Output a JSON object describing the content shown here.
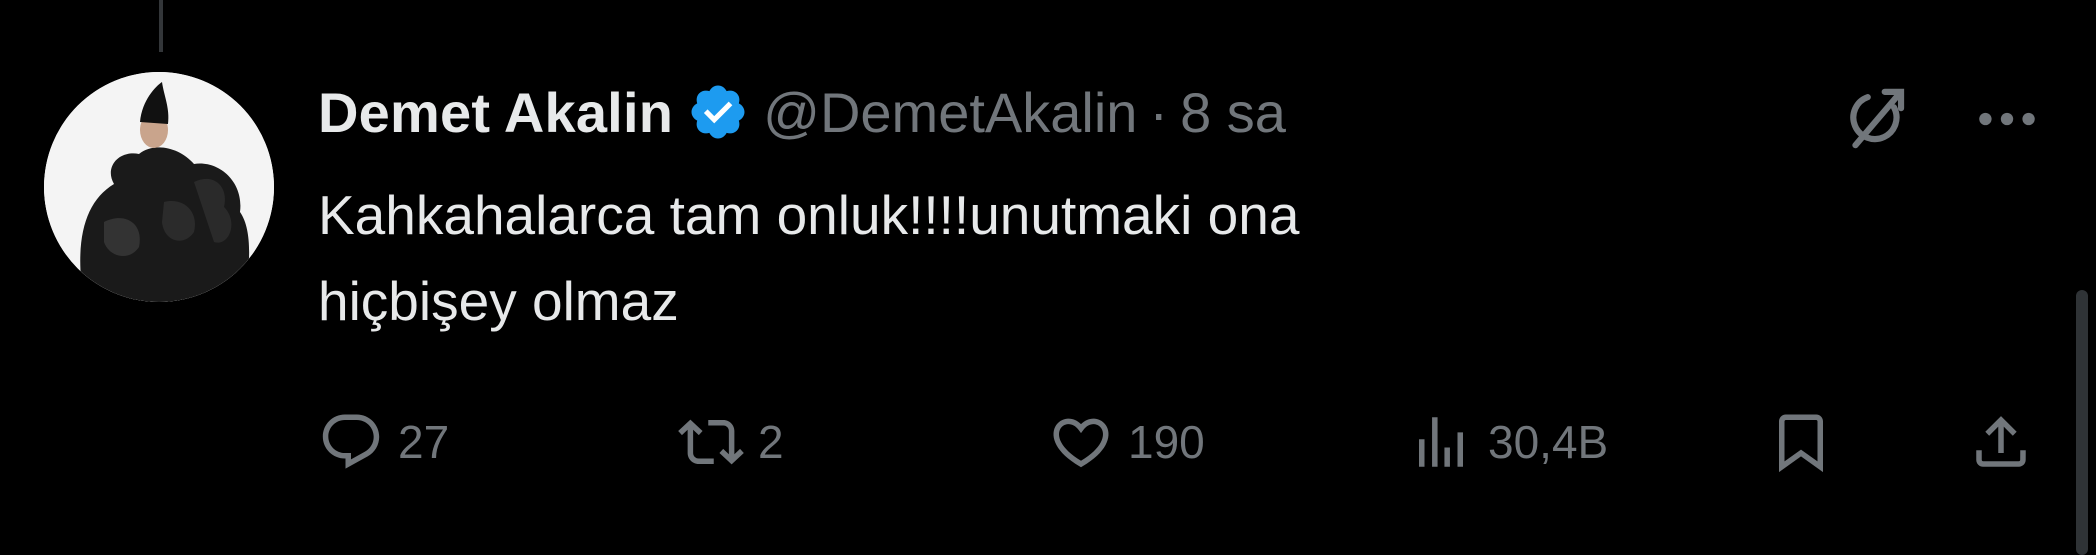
{
  "tweet": {
    "display_name": "Demet Akalin",
    "handle": "@DemetAkalin",
    "separator": "·",
    "time": "8 sa",
    "verified": true,
    "text": "Kahkahalarca tam onluk!!!!unutmaki ona\nhiçbişey olmaz"
  },
  "actions": {
    "reply_count": "27",
    "repost_count": "2",
    "like_count": "190",
    "views_count": "30,4B"
  },
  "icons": {
    "avatar": "avatar-photo",
    "verified": "verified-badge-icon",
    "grok": "grok-icon",
    "more": "more-icon",
    "reply": "reply-icon",
    "repost": "repost-icon",
    "like": "heart-icon",
    "views": "views-icon",
    "bookmark": "bookmark-icon",
    "share": "share-icon"
  },
  "colors": {
    "background": "#000000",
    "primary_text": "#e7e9ea",
    "secondary_text": "#71767b",
    "verified_blue": "#1d9bf0"
  }
}
